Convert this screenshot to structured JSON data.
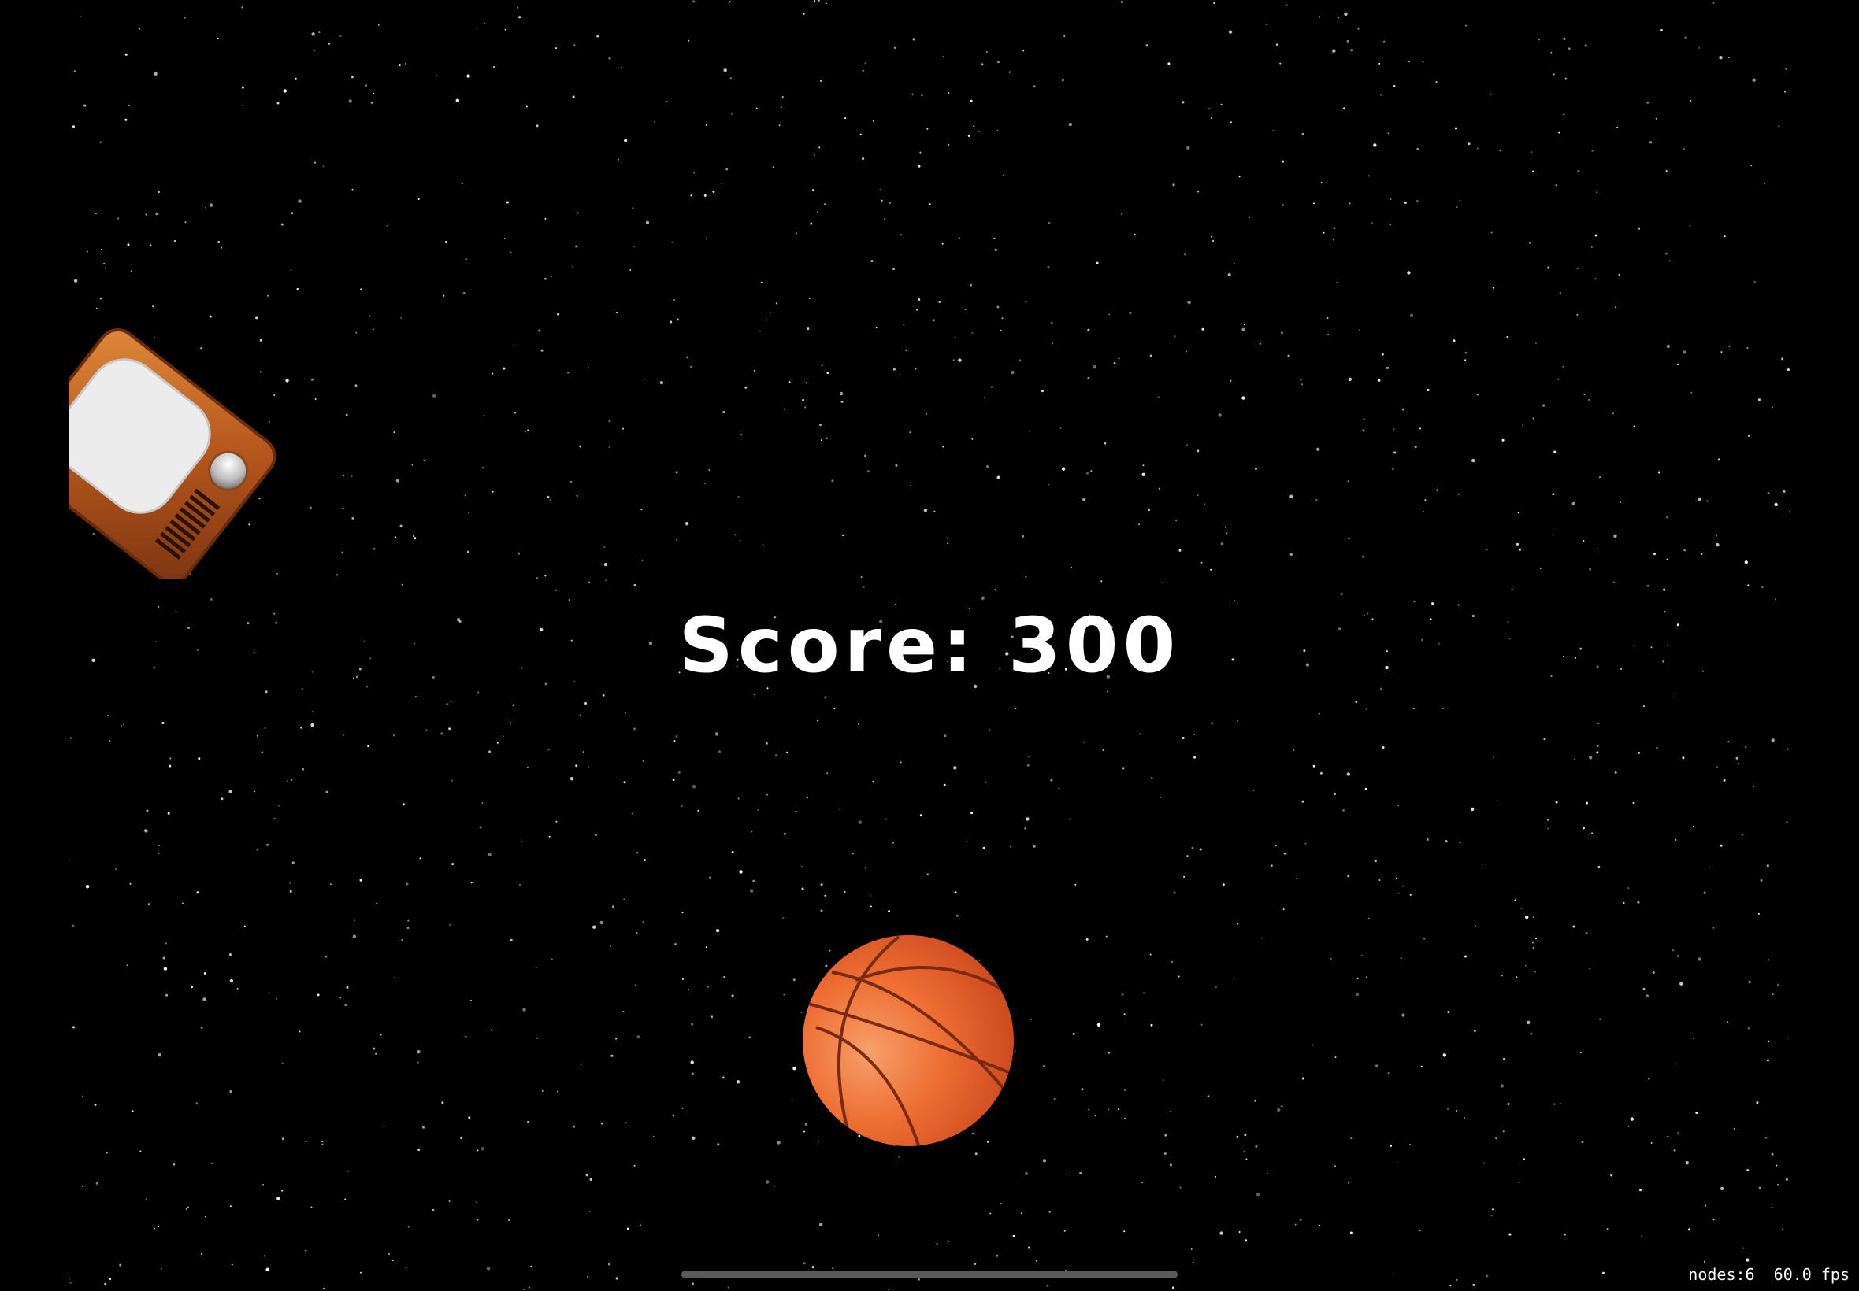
{
  "game": {
    "score_text": "Score: 300"
  },
  "debug": {
    "stats_text": "nodes:6  60.0 fps"
  },
  "sprites": {
    "tv_icon": "retro-tv-icon",
    "ball_icon": "basketball-icon"
  },
  "colors": {
    "background": "#000000",
    "score_text": "#ffffff",
    "ball_orange": "#e8612a",
    "tv_wood": "#b5561b",
    "tv_screen": "#ececec"
  }
}
